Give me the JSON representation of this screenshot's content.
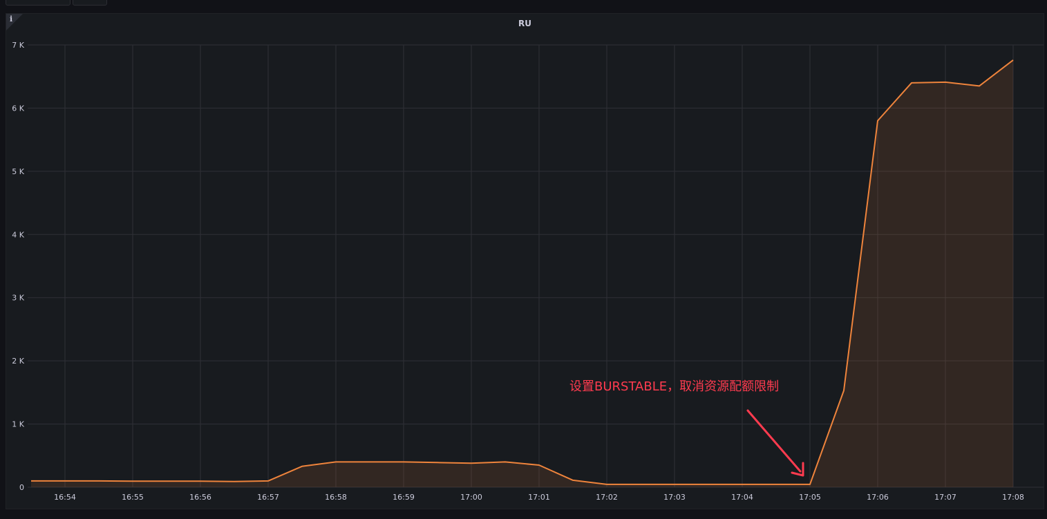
{
  "panel": {
    "title": "RU"
  },
  "annotation": {
    "text": "设置BURSTABLE，取消资源配额限制",
    "color": "#ff3b4f"
  },
  "colors": {
    "series": "#ef843c",
    "grid": "#2f3037",
    "tick_text": "#ccccdc"
  },
  "chart_data": {
    "type": "area",
    "title": "RU",
    "xlabel": "",
    "ylabel": "",
    "ylim": [
      0,
      7000
    ],
    "yticks": [
      0,
      1000,
      2000,
      3000,
      4000,
      5000,
      6000,
      7000
    ],
    "ytick_labels": [
      "0",
      "1 K",
      "2 K",
      "3 K",
      "4 K",
      "5 K",
      "6 K",
      "7 K"
    ],
    "xticks": [
      "16:54",
      "16:55",
      "16:56",
      "16:57",
      "16:58",
      "16:59",
      "17:00",
      "17:01",
      "17:02",
      "17:03",
      "17:04",
      "17:05",
      "17:06",
      "17:07",
      "17:08"
    ],
    "grid": true,
    "legend": "none",
    "series": [
      {
        "x": [
          "16:53:30",
          "16:54:00",
          "16:54:30",
          "16:55:00",
          "16:55:30",
          "16:56:00",
          "16:56:30",
          "16:57:00",
          "16:57:30",
          "16:58:00",
          "16:58:30",
          "16:59:00",
          "16:59:30",
          "17:00:00",
          "17:00:30",
          "17:01:00",
          "17:01:30",
          "17:02:00",
          "17:02:30",
          "17:03:00",
          "17:03:30",
          "17:04:00",
          "17:04:30",
          "17:05:00",
          "17:05:30",
          "17:06:00",
          "17:06:30",
          "17:07:00",
          "17:07:30",
          "17:08:00"
        ],
        "values": [
          100,
          100,
          100,
          95,
          95,
          95,
          90,
          100,
          330,
          400,
          400,
          400,
          390,
          380,
          400,
          350,
          110,
          45,
          45,
          45,
          45,
          45,
          45,
          45,
          1530,
          5800,
          6400,
          6410,
          6350,
          6760
        ]
      }
    ]
  }
}
